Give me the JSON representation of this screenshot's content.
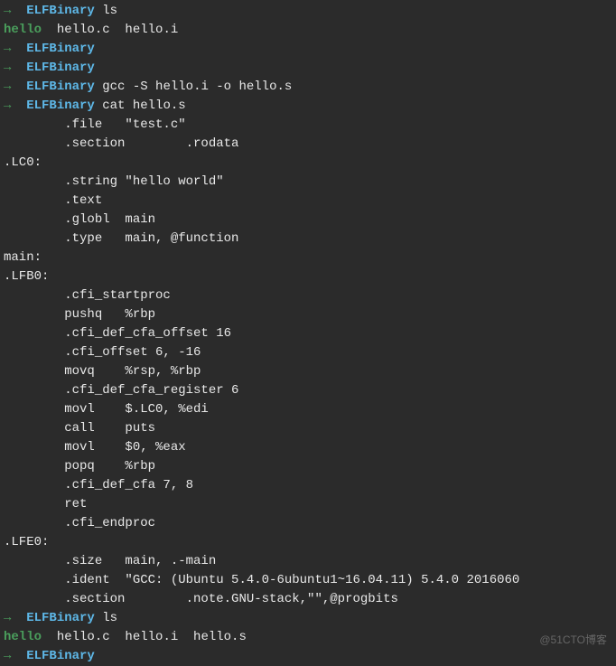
{
  "prompt": {
    "arrow": "→",
    "dir": "ELFBinary"
  },
  "lines": [
    {
      "type": "prompt",
      "cmd": "ls"
    },
    {
      "type": "ls1",
      "exec": "hello",
      "files": "  hello.c  hello.i"
    },
    {
      "type": "prompt",
      "cmd": ""
    },
    {
      "type": "prompt",
      "cmd": ""
    },
    {
      "type": "prompt",
      "cmd": "gcc -S hello.i -o hello.s"
    },
    {
      "type": "prompt",
      "cmd": "cat hello.s"
    },
    {
      "type": "output",
      "text": "        .file   \"test.c\""
    },
    {
      "type": "output",
      "text": "        .section        .rodata"
    },
    {
      "type": "output",
      "text": ".LC0:"
    },
    {
      "type": "output",
      "text": "        .string \"hello world\""
    },
    {
      "type": "output",
      "text": "        .text"
    },
    {
      "type": "output",
      "text": "        .globl  main"
    },
    {
      "type": "output",
      "text": "        .type   main, @function"
    },
    {
      "type": "output",
      "text": "main:"
    },
    {
      "type": "output",
      "text": ".LFB0:"
    },
    {
      "type": "output",
      "text": "        .cfi_startproc"
    },
    {
      "type": "output",
      "text": "        pushq   %rbp"
    },
    {
      "type": "output",
      "text": "        .cfi_def_cfa_offset 16"
    },
    {
      "type": "output",
      "text": "        .cfi_offset 6, -16"
    },
    {
      "type": "output",
      "text": "        movq    %rsp, %rbp"
    },
    {
      "type": "output",
      "text": "        .cfi_def_cfa_register 6"
    },
    {
      "type": "output",
      "text": "        movl    $.LC0, %edi"
    },
    {
      "type": "output",
      "text": "        call    puts"
    },
    {
      "type": "output",
      "text": "        movl    $0, %eax"
    },
    {
      "type": "output",
      "text": "        popq    %rbp"
    },
    {
      "type": "output",
      "text": "        .cfi_def_cfa 7, 8"
    },
    {
      "type": "output",
      "text": "        ret"
    },
    {
      "type": "output",
      "text": "        .cfi_endproc"
    },
    {
      "type": "output",
      "text": ".LFE0:"
    },
    {
      "type": "output",
      "text": "        .size   main, .-main"
    },
    {
      "type": "output",
      "text": "        .ident  \"GCC: (Ubuntu 5.4.0-6ubuntu1~16.04.11) 5.4.0 2016060"
    },
    {
      "type": "output",
      "text": "        .section        .note.GNU-stack,\"\",@progbits"
    },
    {
      "type": "prompt",
      "cmd": "ls"
    },
    {
      "type": "ls2",
      "exec": "hello",
      "files": "  hello.c  hello.i  hello.s"
    },
    {
      "type": "prompt",
      "cmd": ""
    }
  ],
  "watermark": "@51CTO博客"
}
